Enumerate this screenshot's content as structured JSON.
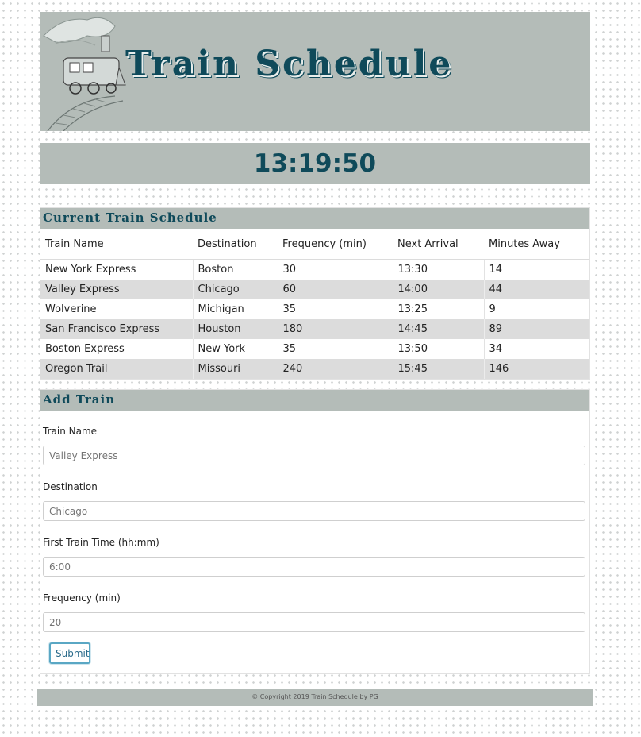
{
  "header": {
    "title": "Train Schedule"
  },
  "clock": {
    "time": "13:19:50"
  },
  "schedule": {
    "title": "Current Train Schedule",
    "columns": [
      "Train Name",
      "Destination",
      "Frequency (min)",
      "Next Arrival",
      "Minutes Away"
    ],
    "rows": [
      [
        "New York Express",
        "Boston",
        "30",
        "13:30",
        "14"
      ],
      [
        "Valley Express",
        "Chicago",
        "60",
        "14:00",
        "44"
      ],
      [
        "Wolverine",
        "Michigan",
        "35",
        "13:25",
        "9"
      ],
      [
        "San Francisco Express",
        "Houston",
        "180",
        "14:45",
        "89"
      ],
      [
        "Boston Express",
        "New York",
        "35",
        "13:50",
        "34"
      ],
      [
        "Oregon Trail",
        "Missouri",
        "240",
        "15:45",
        "146"
      ]
    ]
  },
  "form": {
    "title": "Add Train",
    "train_name": {
      "label": "Train Name",
      "placeholder": "Valley Express"
    },
    "destination": {
      "label": "Destination",
      "placeholder": "Chicago"
    },
    "first_time": {
      "label": "First Train Time (hh:mm)",
      "placeholder": "6:00"
    },
    "frequency": {
      "label": "Frequency (min)",
      "placeholder": "20"
    },
    "submit_label": "Submit"
  },
  "footer": {
    "text": "© Copyright 2019 Train Schedule by PG"
  },
  "colors": {
    "header_bg": "#b4bcb8",
    "accent": "#0f4a5a",
    "row_stripe": "#dcdcdc"
  }
}
